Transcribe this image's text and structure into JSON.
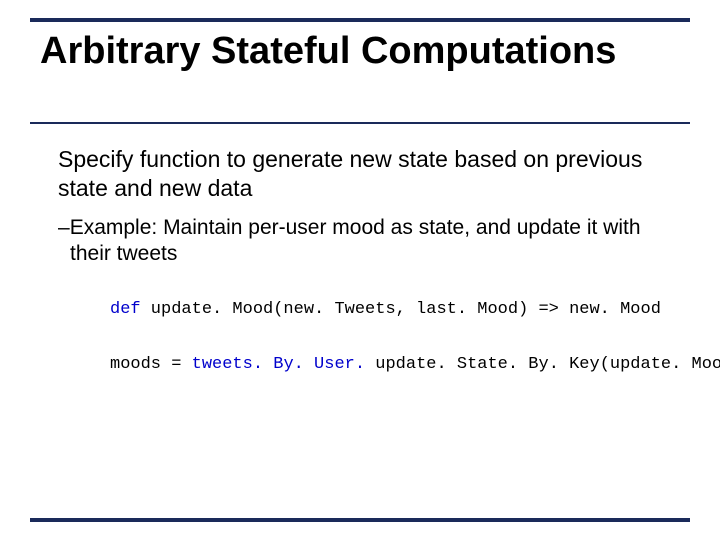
{
  "slide": {
    "title": "Arbitrary Stateful Computations",
    "summary": "Specify function to generate new state based on previous state and new data",
    "example_label": "Example:",
    "example_text": " Maintain per-user mood as state, and update it with their tweets",
    "code1": {
      "kw": "def",
      "rest": " update. Mood(new. Tweets, last. Mood) => new. Mood"
    },
    "code2": {
      "lhs": "moods = ",
      "mid": "tweets. By. User. ",
      "call": "update. State. By. Key",
      "args": "(update. Mood _)"
    }
  }
}
